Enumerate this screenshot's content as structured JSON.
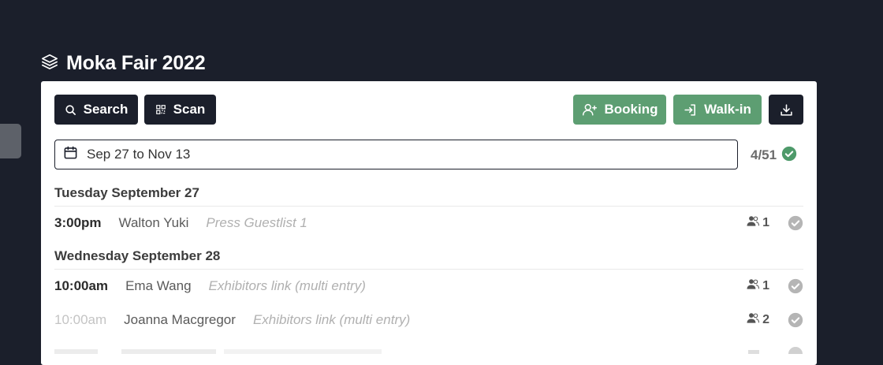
{
  "app": {
    "title": "Moka Fair 2022"
  },
  "toolbar": {
    "search_label": "Search",
    "scan_label": "Scan",
    "booking_label": "Booking",
    "walkin_label": "Walk-in"
  },
  "date_filter": {
    "value": "Sep 27 to Nov 13"
  },
  "counter": {
    "text": "4/51"
  },
  "colors": {
    "dark": "#1b1f2b",
    "green": "#5d9e72",
    "check_gray": "#b5b5b5"
  },
  "days": [
    {
      "header": "Tuesday September 27",
      "bookings": [
        {
          "time": "3:00pm",
          "name": "Walton Yuki",
          "tag": "Press Guestlist 1",
          "guests": "1",
          "time_faded": false
        }
      ]
    },
    {
      "header": "Wednesday September 28",
      "bookings": [
        {
          "time": "10:00am",
          "name": "Ema Wang",
          "tag": "Exhibitors link (multi entry)",
          "guests": "1",
          "time_faded": false
        },
        {
          "time": "10:00am",
          "name": "Joanna Macgregor",
          "tag": "Exhibitors link (multi entry)",
          "guests": "2",
          "time_faded": true
        }
      ]
    }
  ]
}
